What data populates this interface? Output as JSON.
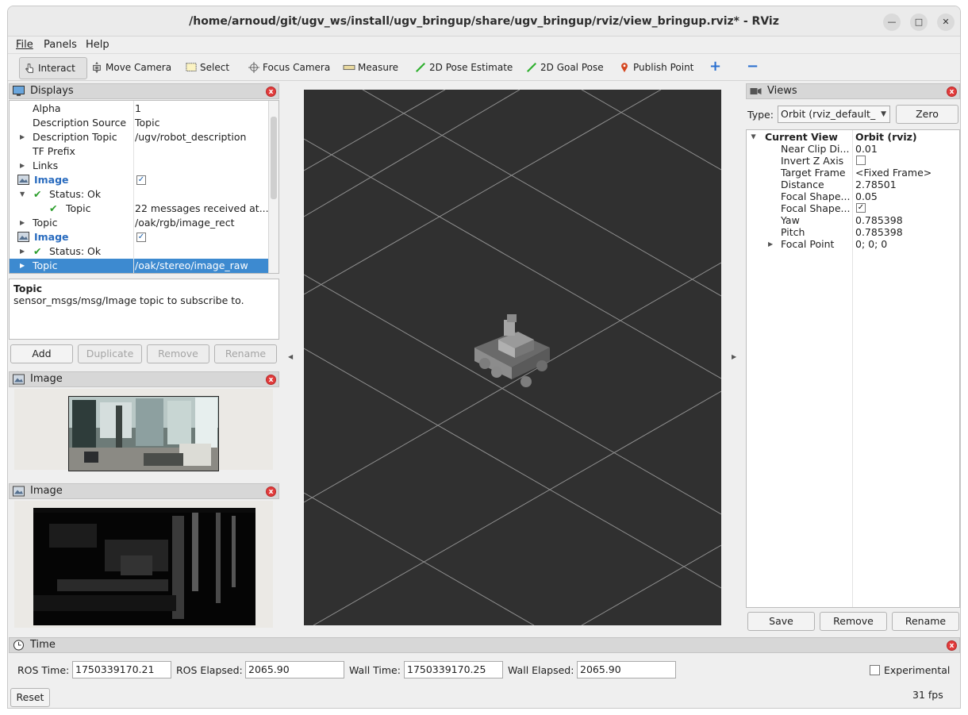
{
  "window": {
    "title": "/home/arnoud/git/ugv_ws/install/ugv_bringup/share/ugv_bringup/rviz/view_bringup.rviz* - RViz"
  },
  "menu": {
    "file": "File",
    "panels": "Panels",
    "help": "Help"
  },
  "toolbar": {
    "interact": "Interact",
    "move_camera": "Move Camera",
    "select": "Select",
    "focus_camera": "Focus Camera",
    "measure": "Measure",
    "pose_estimate": "2D Pose Estimate",
    "goal_pose": "2D Goal Pose",
    "publish_point": "Publish Point",
    "add_tool": "+",
    "remove_tool": "−"
  },
  "displays": {
    "title": "Displays",
    "rows": [
      {
        "key": "Alpha",
        "value": "1"
      },
      {
        "key": "Description Source",
        "value": "Topic"
      },
      {
        "key": "Description Topic",
        "value": "/ugv/robot_description"
      },
      {
        "key": "TF Prefix",
        "value": ""
      },
      {
        "key": "Links",
        "value": ""
      },
      {
        "key": "Image",
        "value": ""
      },
      {
        "key": "Status: Ok",
        "value": ""
      },
      {
        "key": "Topic",
        "value": "22 messages received at..."
      },
      {
        "key": "Topic",
        "value": "/oak/rgb/image_rect"
      },
      {
        "key": "Image",
        "value": ""
      },
      {
        "key": "Status: Ok",
        "value": ""
      },
      {
        "key": "Topic",
        "value": "/oak/stereo/image_raw"
      }
    ],
    "desc_title": "Topic",
    "desc_text": "sensor_msgs/msg/Image topic to subscribe to.",
    "buttons": {
      "add": "Add",
      "duplicate": "Duplicate",
      "remove": "Remove",
      "rename": "Rename"
    }
  },
  "image_panel_1": {
    "title": "Image"
  },
  "image_panel_2": {
    "title": "Image"
  },
  "views": {
    "title": "Views",
    "type_label": "Type:",
    "type_value": "Orbit (rviz_default_",
    "zero": "Zero",
    "current_view": "Current View",
    "current_view_value": "Orbit (rviz)",
    "props": [
      {
        "key": "Near Clip Di...",
        "value": "0.01"
      },
      {
        "key": "Invert Z Axis",
        "value": ""
      },
      {
        "key": "Target Frame",
        "value": "<Fixed Frame>"
      },
      {
        "key": "Distance",
        "value": "2.78501"
      },
      {
        "key": "Focal Shape...",
        "value": "0.05"
      },
      {
        "key": "Focal Shape...",
        "value": ""
      },
      {
        "key": "Yaw",
        "value": "0.785398"
      },
      {
        "key": "Pitch",
        "value": "0.785398"
      },
      {
        "key": "Focal Point",
        "value": "0; 0; 0"
      }
    ],
    "buttons": {
      "save": "Save",
      "remove": "Remove",
      "rename": "Rename"
    }
  },
  "time": {
    "title": "Time",
    "ros_time_label": "ROS Time:",
    "ros_time": "1750339170.21",
    "ros_elapsed_label": "ROS Elapsed:",
    "ros_elapsed": "2065.90",
    "wall_time_label": "Wall Time:",
    "wall_time": "1750339170.25",
    "wall_elapsed_label": "Wall Elapsed:",
    "wall_elapsed": "2065.90",
    "experimental": "Experimental",
    "reset": "Reset",
    "fps": "31 fps"
  }
}
